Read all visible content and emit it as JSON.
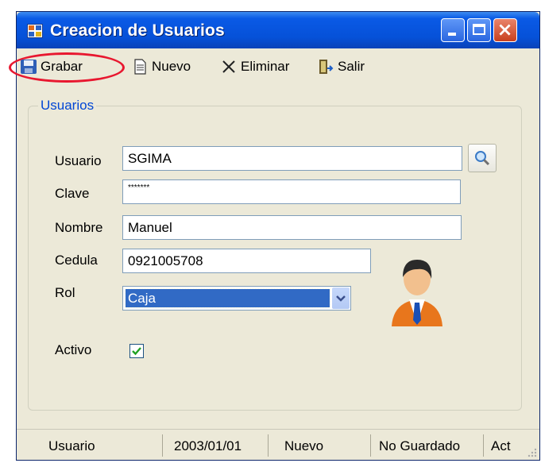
{
  "window": {
    "title": "Creacion de Usuarios",
    "title_bar_color": "#0651d8",
    "close_button_color": "#c8401e"
  },
  "toolbar": {
    "items": [
      {
        "label": "Grabar",
        "icon": "save-floppy-icon"
      },
      {
        "label": "Nuevo",
        "icon": "new-document-icon"
      },
      {
        "label": "Eliminar",
        "icon": "delete-x-icon"
      },
      {
        "label": "Salir",
        "icon": "exit-door-icon"
      }
    ],
    "highlight_color": "#e8172f"
  },
  "group": {
    "title": "Usuarios"
  },
  "form": {
    "usuario": {
      "label": "Usuario",
      "value": "SGIMA"
    },
    "clave": {
      "label": "Clave",
      "value": "*******"
    },
    "nombre": {
      "label": "Nombre",
      "value": "Manuel"
    },
    "cedula": {
      "label": "Cedula",
      "value": "0921005708"
    },
    "rol": {
      "label": "Rol",
      "value": "Caja"
    },
    "activo": {
      "label": "Activo",
      "checked": true
    }
  },
  "statusbar": {
    "items": [
      "Usuario",
      "2003/01/01",
      "Nuevo",
      "No Guardado",
      "Act"
    ]
  }
}
